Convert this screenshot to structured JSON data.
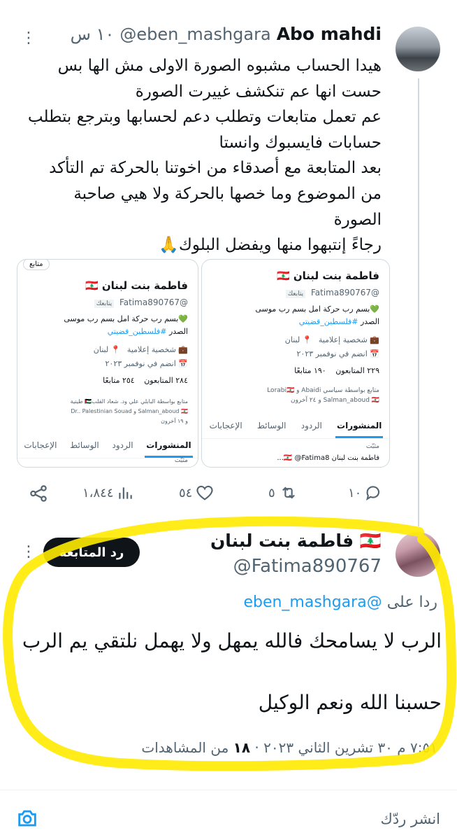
{
  "colors": {
    "accent": "#1d9bf0",
    "highlighter": "#ffea00",
    "text": "#0f1419",
    "muted": "#536471"
  },
  "tweet": {
    "author_name": "Abo mahdi",
    "handle": "@eben_mashgara",
    "time": "١٠ س",
    "lines": [
      "هيدا الحساب مشبوه الصورة الاولى مش الها بس",
      "حست انها عم تنكشف غييرت الصورة",
      "عم تعمل متابعات وتطلب دعم لحسابها وبترجع بتطلب",
      "حسابات فايسبوك وانستا",
      "بعد المتابعة مع أصدقاء من اخوتنا بالحركة تم التأكد",
      "من الموضوع وما خصها بالحركة ولا هيي صاحبة",
      "الصورة",
      "رجاءً إنتبهوا منها ويفضل البلوك🙏"
    ],
    "card_right": {
      "name": "فاطمة بنت لبنان 🇱🇧",
      "handle": "@Fatima890767",
      "follows_you": "يتابعك",
      "bio_line1": "💚بسم رب حركة امل بسم رب موسى",
      "bio_line2": "الصدر",
      "bio_hashtag": "#فلسطين_قضيتي",
      "category": "شخصية إعلامية",
      "location": "لبنان",
      "joined": "انضم في نوفمبر ٢٠٢٣",
      "followers": "٢٢٩ المتابعون",
      "following": "١٩٠ متابعًا",
      "followed_by_1": "متابع بواسطة سياسي Abaidi و Lorabi🇱🇧",
      "followed_by_2": "Salman_aboud 🇱🇧 و ٢٤ آخرون",
      "tabs": [
        "المنشورات",
        "الردود",
        "الوسائط",
        "الإعجابات"
      ],
      "pinned": "مثبّت",
      "pinned_post": "فاطمة بنت لبنان 🇱🇧 @Fatima8..."
    },
    "card_left": {
      "name": "فاطمة بنت لبنان 🇱🇧",
      "handle": "@Fatima890767",
      "follows_you": "يتابعك",
      "bio_line1": "💚بسم رب حركة امل بسم رب موسى",
      "bio_line2": "الصدر",
      "bio_hashtag": "#فلسطين_قضيتي",
      "category": "شخصية إعلامية",
      "location": "لبنان",
      "joined": "انضم في نوفمبر ٢٠٢٣",
      "followers": "٢٨٤ المتابعون",
      "following": "٢٥٤ متابعًا",
      "followed_by_1": "متابع بواسطة البابلي علي ود. شعاد القلب🇵🇸 طينية",
      "followed_by_2": "Salman_aboud 🇱🇧 و Dr.. Palestinian Souad",
      "followed_by_3": "و ١٩ آخرون",
      "follow_label": "متابع",
      "tabs": [
        "المنشورات",
        "الردود",
        "الوسائط",
        "الإعجابات"
      ],
      "pinned": "مثبّت"
    },
    "actions": {
      "replies": "١٠",
      "reposts": "٥",
      "likes": "٥٤",
      "views": "١،٨٤٤"
    }
  },
  "reply": {
    "follow_button": "رد المتابعة",
    "author_name": "فاطمة بنت لبنان 🇱🇧",
    "handle": "@Fatima890767",
    "replying_prefix": "ردا على",
    "replying_handle": "@eben_mashgara",
    "lines": [
      "الرب لا يسامحك فالله يمهل ولا يهمل نلتقي يم الرب",
      "",
      "حسبنا الله ونعم الوكيل"
    ],
    "meta_prefix": "٧:٥١ م ٣٠ تشرين الثاني ٢٠٢٣ ·",
    "views_count": "١٨",
    "views_label": "من المشاهدات"
  },
  "composer": {
    "placeholder": "انشر ردّك"
  }
}
